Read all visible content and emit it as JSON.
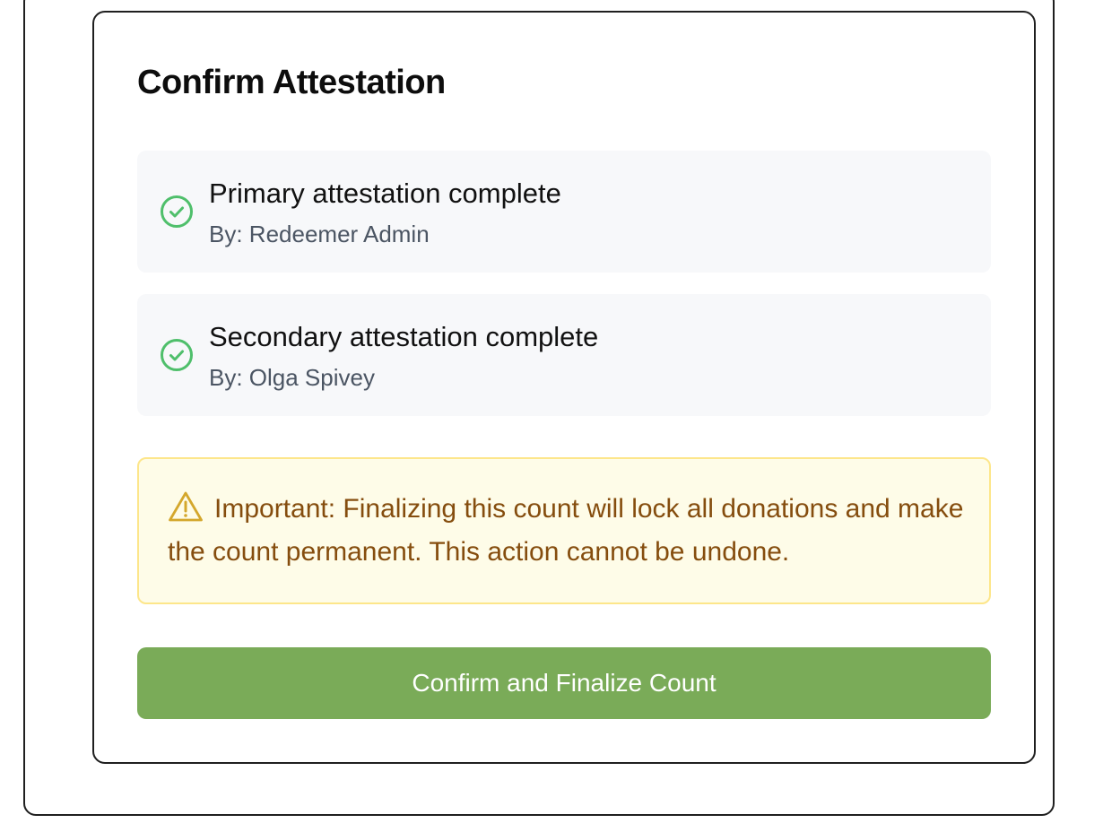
{
  "dialog": {
    "title": "Confirm Attestation"
  },
  "attestations": [
    {
      "title": "Primary attestation complete",
      "by": "By: Redeemer Admin",
      "icon": "check-circle-icon"
    },
    {
      "title": "Secondary attestation complete",
      "by": "By: Olga Spivey",
      "icon": "check-circle-icon"
    }
  ],
  "warning": {
    "icon": "warning-triangle-icon",
    "text": "Important: Finalizing this count will lock all donations and make the count permanent. This action cannot be undone."
  },
  "actions": {
    "confirm_label": "Confirm and Finalize Count"
  },
  "colors": {
    "success": "#4fbf6b",
    "warning_text": "#854d0e",
    "warning_bg": "#fefce8",
    "warning_border": "#fde68a",
    "button_bg": "#7aab58"
  }
}
